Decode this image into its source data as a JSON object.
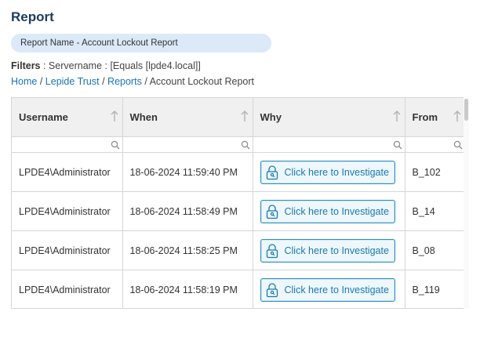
{
  "page": {
    "title": "Report",
    "report_name": "Report Name - Account Lockout Report",
    "filters_label": "Filters",
    "filters_value": " : Servername : [Equals [lpde4.local]]"
  },
  "breadcrumb": {
    "items": [
      "Home",
      "Lepide Trust",
      "Reports"
    ],
    "current": "Account Lockout Report",
    "separator": "/"
  },
  "table": {
    "columns": [
      "Username",
      "When",
      "Why",
      "From"
    ],
    "button_label": "Click here to Investigate",
    "rows": [
      {
        "username": "LPDE4\\Administrator",
        "when": "18-06-2024 11:59:40 PM",
        "from": "B_102"
      },
      {
        "username": "LPDE4\\Administrator",
        "when": "18-06-2024 11:58:49 PM",
        "from": "B_14"
      },
      {
        "username": "LPDE4\\Administrator",
        "when": "18-06-2024 11:58:25 PM",
        "from": "B_08"
      },
      {
        "username": "LPDE4\\Administrator",
        "when": "18-06-2024 11:58:19 PM",
        "from": "B_119"
      }
    ]
  },
  "icons": {
    "sort": "sort-up-arrow-icon",
    "filter": "magnifier-icon",
    "investigate": "lock-search-icon"
  },
  "colors": {
    "title": "#1e3a5f",
    "link": "#1a73b8",
    "pill": "#dce9f8",
    "button_border": "#2a8fc0",
    "button_text": "#1a7ab0",
    "header_bg": "#f0f0f0"
  }
}
